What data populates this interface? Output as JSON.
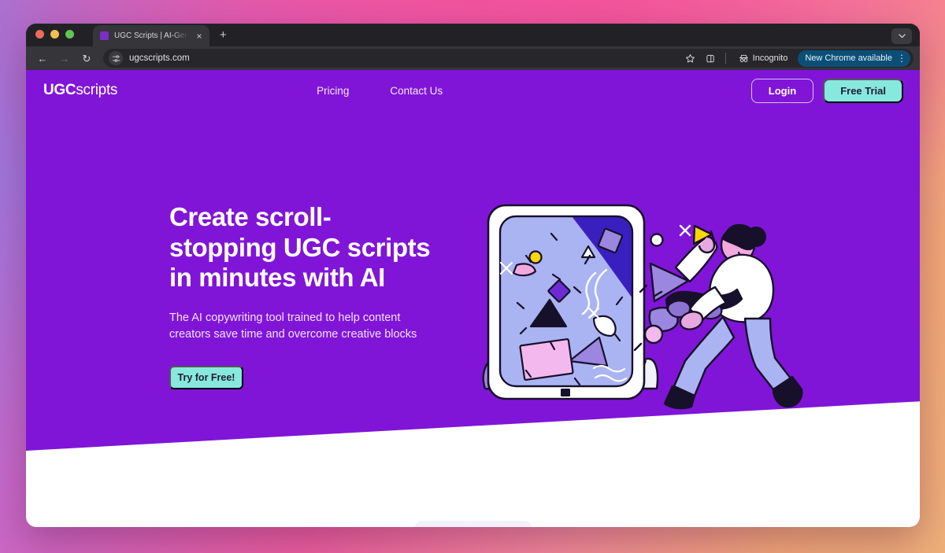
{
  "browser": {
    "traffic_lights": [
      "close",
      "minimize",
      "maximize"
    ],
    "tab": {
      "title": "UGC Scripts | AI-Generated U",
      "favicon": "ugcscripts-favicon",
      "close_label": "×"
    },
    "new_tab_label": "+",
    "tab_list_icon": "chevron-down-icon",
    "toolbar": {
      "back_label": "←",
      "forward_label": "→",
      "reload_label": "↻",
      "site_info_icon": "tune-icon",
      "url": "ugcscripts.com",
      "bookmark_icon": "star-icon",
      "split_view_icon": "split-tab-icon",
      "incognito_label": "Incognito",
      "incognito_icon": "incognito-icon",
      "update_label": "New Chrome available",
      "menu_label": "⋮"
    }
  },
  "site": {
    "logo": {
      "bold": "UGC",
      "light": "scripts"
    },
    "nav_links": [
      {
        "label": "Pricing"
      },
      {
        "label": "Contact Us"
      }
    ],
    "actions": {
      "login_label": "Login",
      "trial_label": "Free Trial"
    },
    "hero": {
      "headline_lines": [
        "Create scroll-",
        "stopping UGC scripts",
        "in minutes with AI"
      ],
      "subhead": "The AI copywriting tool trained to help content creators save time and overcome creative blocks",
      "cta_label": "Try for Free!",
      "illustration": "tablet-with-floating-shapes-and-person"
    },
    "colors": {
      "hero_purple": "#8015d8",
      "mint_accent": "#87e8dd",
      "dark_text": "#201b3a",
      "tablet_screen": "#aab4f2",
      "tablet_screen_dark": "#3a1fbf"
    }
  }
}
